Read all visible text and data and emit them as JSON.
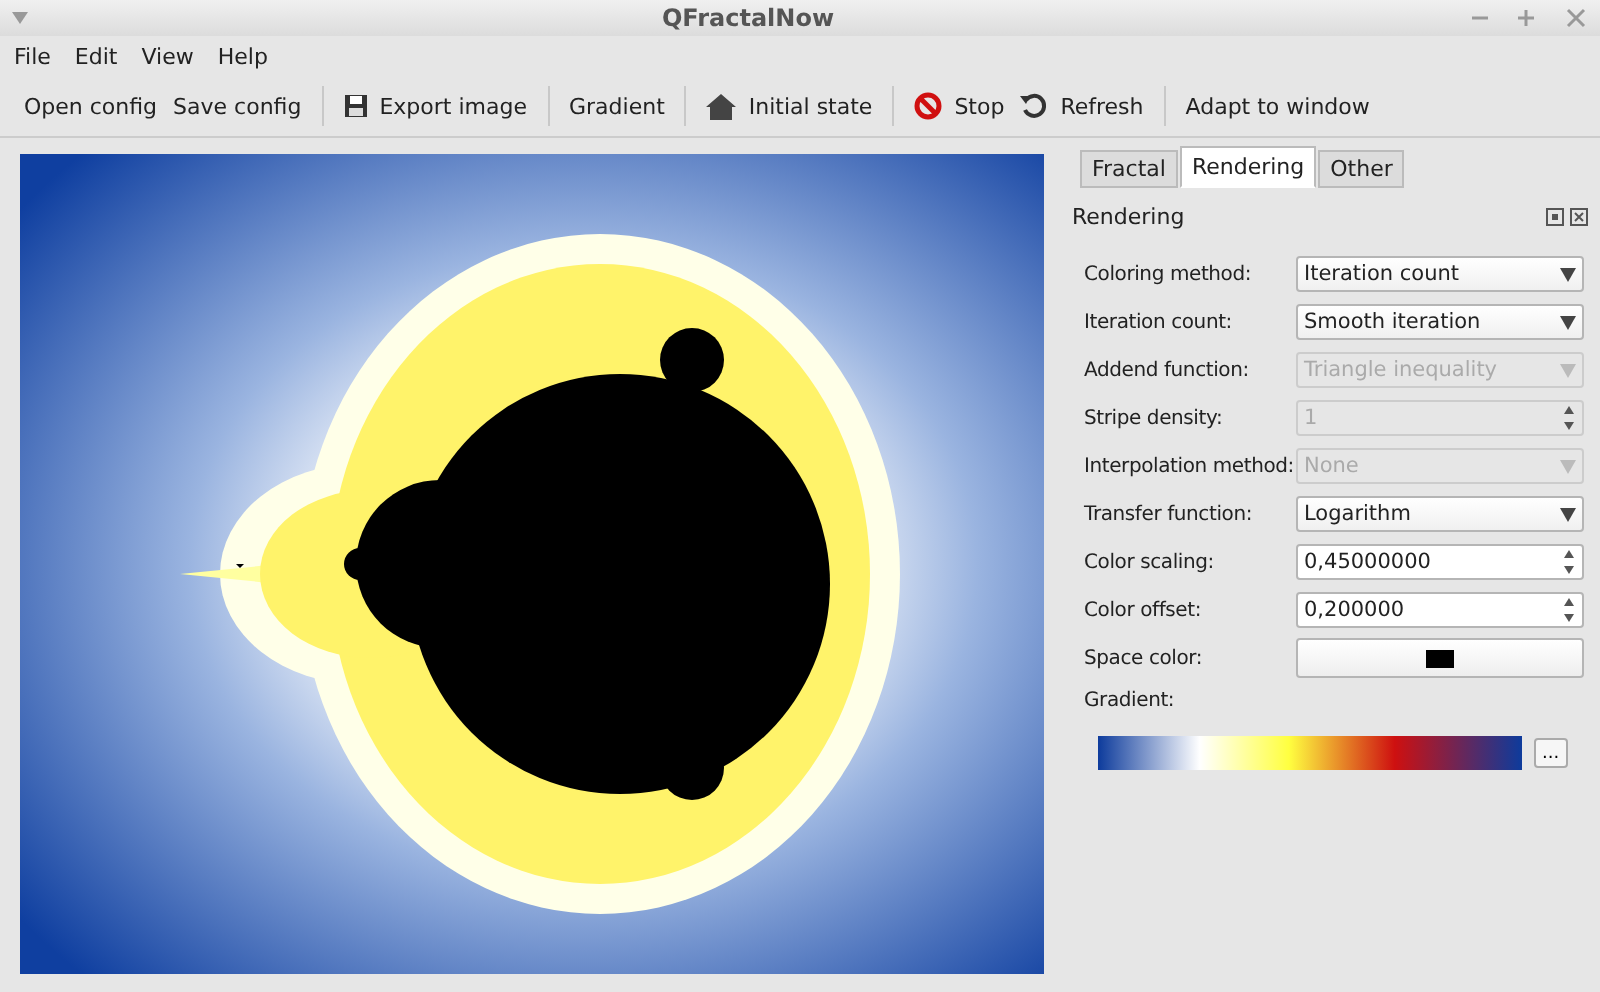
{
  "window": {
    "title": "QFractalNow"
  },
  "menu": [
    "File",
    "Edit",
    "View",
    "Help"
  ],
  "toolbar_groups": [
    [
      {
        "label": "Open config",
        "kind": "plain"
      },
      {
        "label": "Save config",
        "kind": "plain"
      }
    ],
    [
      {
        "label": "Export image",
        "kind": "save"
      }
    ],
    [
      {
        "label": "Gradient",
        "kind": "plain"
      }
    ],
    [
      {
        "label": "Initial state",
        "kind": "home"
      }
    ],
    [
      {
        "label": "Stop",
        "kind": "stop"
      },
      {
        "label": "Refresh",
        "kind": "refresh"
      }
    ],
    [
      {
        "label": "Adapt to window",
        "kind": "plain"
      }
    ]
  ],
  "tabs": [
    {
      "label": "Fractal",
      "selected": false
    },
    {
      "label": "Rendering",
      "selected": true
    },
    {
      "label": "Other",
      "selected": false
    }
  ],
  "dock": {
    "title": "Rendering"
  },
  "fields": [
    {
      "label": "Coloring method:",
      "kind": "select",
      "value": "Iteration count",
      "disabled": false
    },
    {
      "label": "Iteration count:",
      "kind": "select",
      "value": "Smooth iteration",
      "disabled": false
    },
    {
      "label": "Addend function:",
      "kind": "select",
      "value": "Triangle inequality",
      "disabled": true
    },
    {
      "label": "Stripe density:",
      "kind": "spin",
      "value": "1",
      "disabled": true
    },
    {
      "label": "Interpolation method:",
      "kind": "select",
      "value": "None",
      "disabled": true
    },
    {
      "label": "Transfer function:",
      "kind": "select",
      "value": "Logarithm",
      "disabled": false
    },
    {
      "label": "Color scaling:",
      "kind": "spin",
      "value": "0,45000000",
      "disabled": false
    },
    {
      "label": "Color offset:",
      "kind": "spin",
      "value": "0,200000",
      "disabled": false
    },
    {
      "label": "Space color:",
      "kind": "color",
      "color": "#000000"
    }
  ],
  "gradient": {
    "label": "Gradient:",
    "button": "..."
  }
}
